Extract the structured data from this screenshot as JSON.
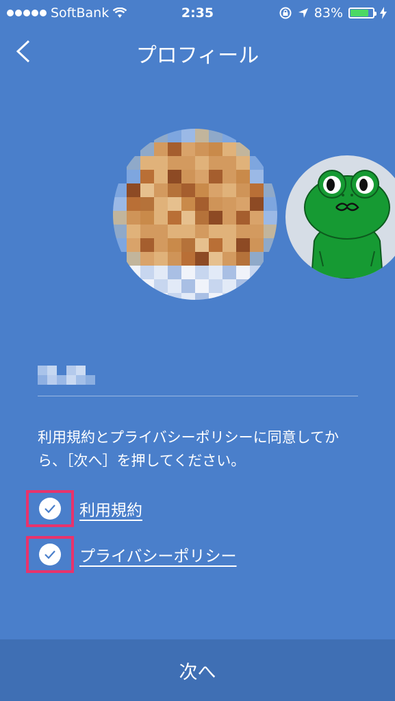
{
  "status_bar": {
    "carrier": "SoftBank",
    "time": "2:35",
    "battery_percent": "83%",
    "battery_level": 0.83,
    "icons": [
      "signal-dots",
      "wifi-icon",
      "rotation-lock-icon",
      "location-arrow-icon",
      "battery-icon",
      "charging-bolt-icon"
    ]
  },
  "nav": {
    "title": "プロフィール",
    "back_icon": "chevron-left-icon"
  },
  "profile": {
    "photo_icon": "pixelated-photo",
    "character_icon": "frog-character"
  },
  "agreement": {
    "message": "利用規約とプライバシーポリシーに同意してから、［次へ］を押してください。",
    "items": [
      {
        "label": "利用規約",
        "checked": true
      },
      {
        "label": "プライバシーポリシー",
        "checked": true
      }
    ]
  },
  "footer": {
    "next_label": "次へ"
  },
  "colors": {
    "background": "#4a7fcb",
    "footer": "#3f6fb4",
    "highlight": "#e8336c",
    "battery": "#4cd964",
    "frog": "#169a33"
  }
}
